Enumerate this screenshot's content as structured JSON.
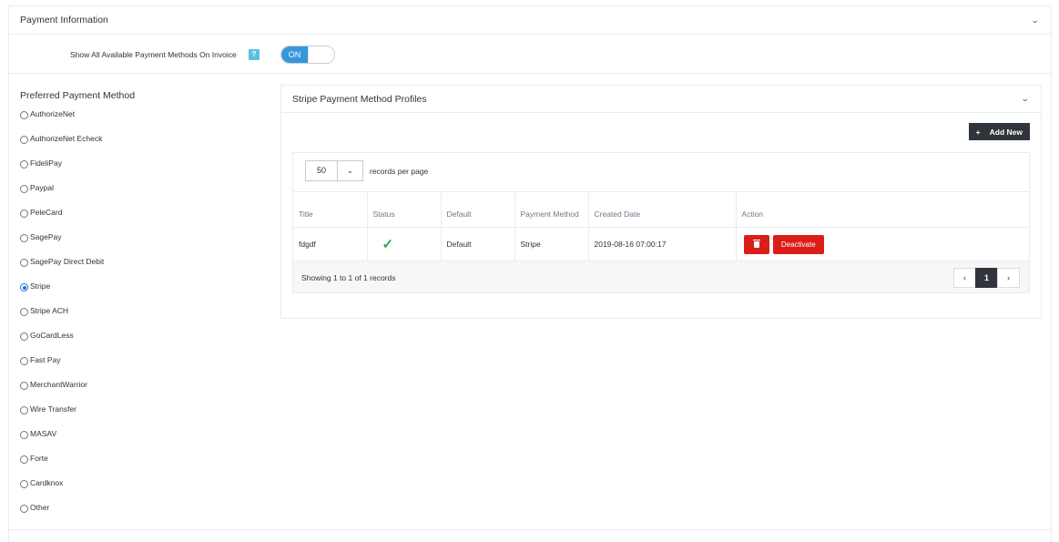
{
  "section": {
    "title": "Payment Information"
  },
  "invoice_toggle": {
    "label": "Show All Available Payment Methods On Invoice",
    "help": "?",
    "state": "ON"
  },
  "preferred": {
    "title": "Preferred Payment Method",
    "selected": "Stripe",
    "options": [
      "AuthorizeNet",
      "AuthorizeNet Echeck",
      "FideliPay",
      "Paypal",
      "PeleCard",
      "SagePay",
      "SagePay Direct Debit",
      "Stripe",
      "Stripe ACH",
      "GoCardLess",
      "Fast Pay",
      "MerchantWarrior",
      "Wire Transfer",
      "MASAV",
      "Forte",
      "Cardknox",
      "Other"
    ]
  },
  "profiles": {
    "title": "Stripe Payment Method Profiles",
    "add_label": "Add New",
    "add_icon": "+",
    "rpp_value": "50",
    "rpp_label": "records per page",
    "columns": [
      "Title",
      "Status",
      "Default",
      "Payment Method",
      "Created Date",
      "Action"
    ],
    "rows": [
      {
        "title": "fdgdf",
        "status": "✓",
        "default": "Default",
        "method": "Stripe",
        "created": "2019-08-16 07:00:17",
        "deactivate": "Deactivate"
      }
    ],
    "showing": "Showing 1 to 1 of 1 records",
    "pager": {
      "prev": "‹",
      "current": "1",
      "next": "›"
    }
  },
  "colors": {
    "primary": "#3598dc",
    "danger": "#d91e18",
    "dark": "#2f353b",
    "success": "#26a65b"
  }
}
